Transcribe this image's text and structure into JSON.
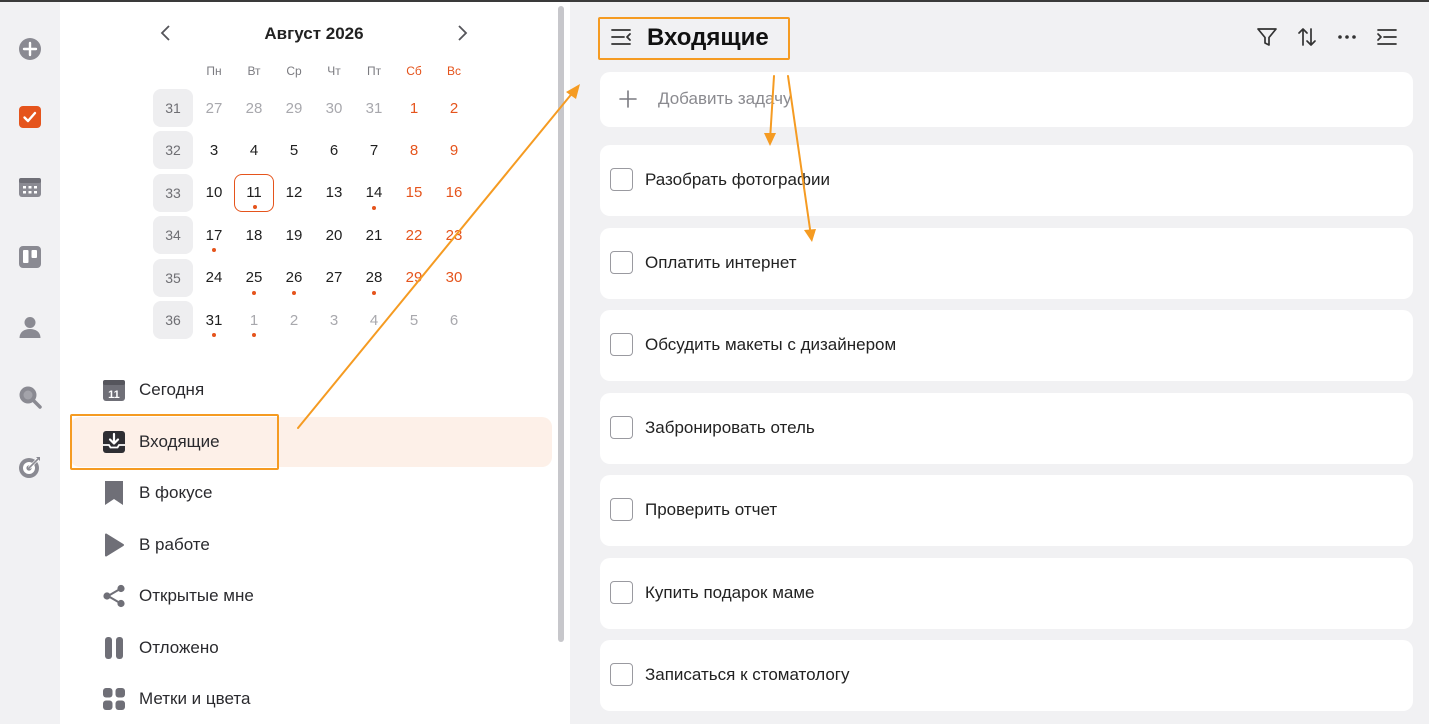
{
  "calendar": {
    "title": "Август 2026",
    "weekdays": [
      "Пн",
      "Вт",
      "Ср",
      "Чт",
      "Пт",
      "Сб",
      "Вс"
    ],
    "weeks": [
      {
        "num": "31",
        "days": [
          {
            "d": "27",
            "other": true
          },
          {
            "d": "28",
            "other": true
          },
          {
            "d": "29",
            "other": true
          },
          {
            "d": "30",
            "other": true
          },
          {
            "d": "31",
            "other": true
          },
          {
            "d": "1"
          },
          {
            "d": "2"
          }
        ]
      },
      {
        "num": "32",
        "days": [
          {
            "d": "3"
          },
          {
            "d": "4"
          },
          {
            "d": "5"
          },
          {
            "d": "6"
          },
          {
            "d": "7"
          },
          {
            "d": "8"
          },
          {
            "d": "9"
          }
        ]
      },
      {
        "num": "33",
        "days": [
          {
            "d": "10"
          },
          {
            "d": "11",
            "today": true,
            "dot": true
          },
          {
            "d": "12"
          },
          {
            "d": "13"
          },
          {
            "d": "14",
            "dot": true
          },
          {
            "d": "15"
          },
          {
            "d": "16"
          }
        ]
      },
      {
        "num": "34",
        "days": [
          {
            "d": "17",
            "dot": true
          },
          {
            "d": "18"
          },
          {
            "d": "19"
          },
          {
            "d": "20"
          },
          {
            "d": "21"
          },
          {
            "d": "22"
          },
          {
            "d": "23"
          }
        ]
      },
      {
        "num": "35",
        "days": [
          {
            "d": "24"
          },
          {
            "d": "25",
            "dot": true
          },
          {
            "d": "26",
            "dot": true
          },
          {
            "d": "27"
          },
          {
            "d": "28",
            "dot": true
          },
          {
            "d": "29"
          },
          {
            "d": "30"
          }
        ]
      },
      {
        "num": "36",
        "days": [
          {
            "d": "31",
            "dot": true
          },
          {
            "d": "1",
            "other": true,
            "dot": true
          },
          {
            "d": "2",
            "other": true
          },
          {
            "d": "3",
            "other": true
          },
          {
            "d": "4",
            "other": true
          },
          {
            "d": "5",
            "other": true
          },
          {
            "d": "6",
            "other": true
          }
        ]
      }
    ]
  },
  "nav": {
    "today": "Сегодня",
    "today_icon_text": "11",
    "inbox": "Входящие",
    "focus": "В фокусе",
    "in_progress": "В работе",
    "shared": "Открытые мне",
    "postponed": "Отложено",
    "tags": "Метки и цвета"
  },
  "main": {
    "title": "Входящие",
    "add_task": "Добавить задачу",
    "tasks": [
      "Разобрать фотографии",
      "Оплатить интернет",
      "Обсудить макеты с дизайнером",
      "Забронировать отель",
      "Проверить отчет",
      "Купить подарок маме",
      "Записаться к стоматологу"
    ]
  },
  "colors": {
    "accent": "#e5541c",
    "annotation": "#f59b22",
    "active_bg": "#fdf0e8"
  },
  "icons": {
    "rail": [
      "plus-circle-icon",
      "task-check-icon",
      "calendar-icon",
      "board-icon",
      "contacts-icon",
      "search-icon",
      "goal-icon"
    ],
    "toolbar": [
      "filter-icon",
      "sort-icon",
      "more-icon",
      "collapse-icon"
    ]
  }
}
